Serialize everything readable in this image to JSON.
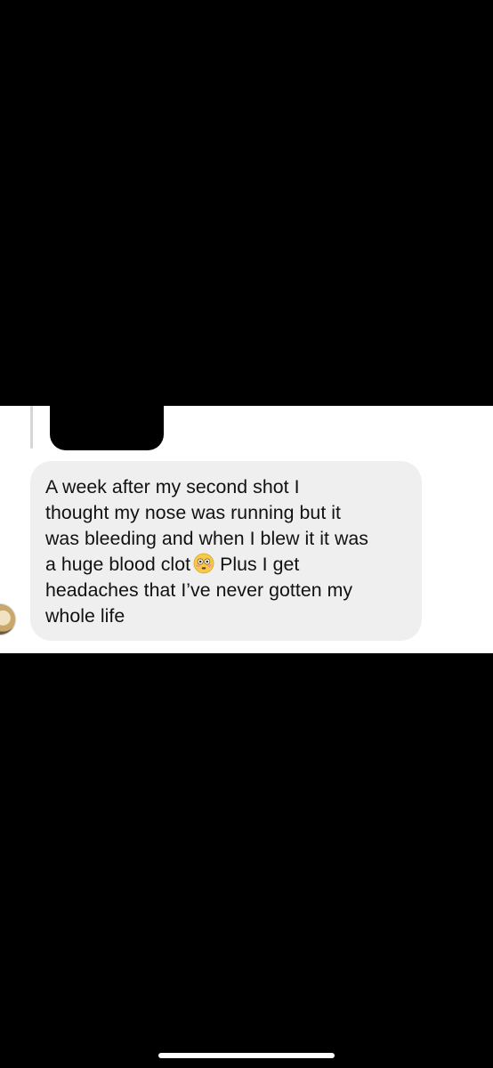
{
  "message": {
    "line1": "A week after my second shot I",
    "line2": "thought my nose was running but it",
    "line3": "was bleeding and when I blew it it was",
    "line4_before_emoji": "a huge blood clot",
    "emoji_icon": "flushed-face-emoji",
    "line4_after_emoji": "Plus I get",
    "line5": "headaches that I’ve never gotten my",
    "line6": "whole life"
  },
  "colors": {
    "bubble_background": "#efefef",
    "text": "#111111",
    "redaction": "#000000"
  }
}
